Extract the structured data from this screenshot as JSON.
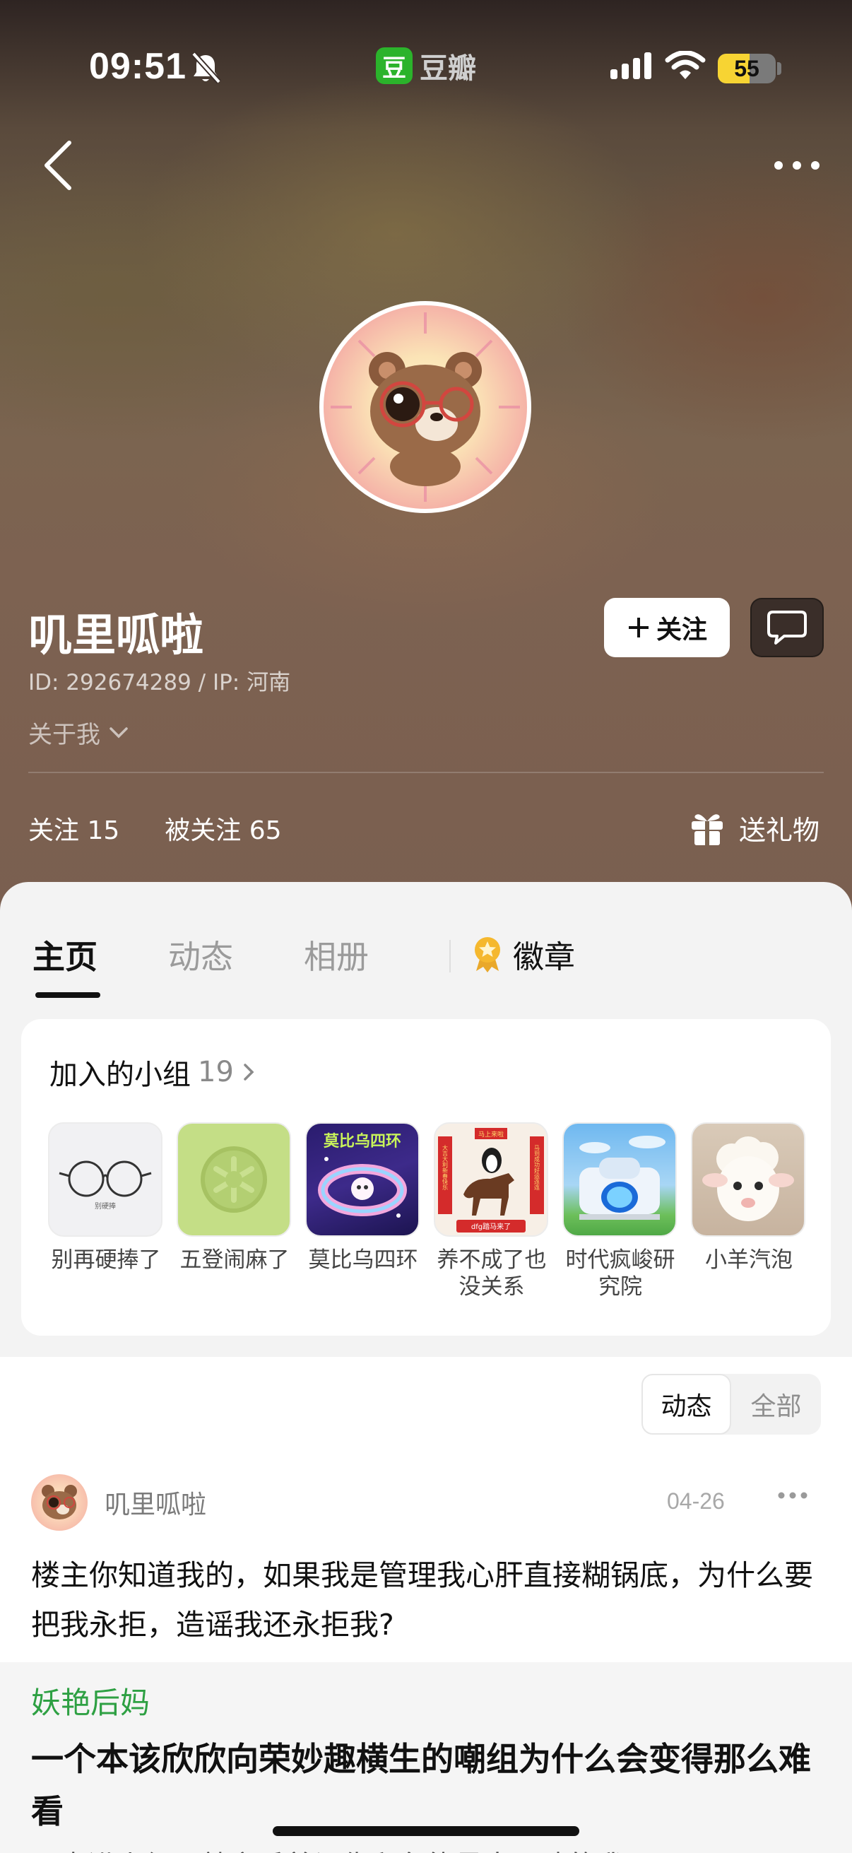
{
  "status_bar": {
    "time": "09:51",
    "app_logo_char": "豆",
    "app_name": "豆瓣",
    "battery_percent": 55,
    "battery_text": "55",
    "icons": [
      "bell-muted-icon",
      "signal-icon",
      "wifi-icon",
      "battery-icon"
    ]
  },
  "nav": {
    "back_icon": "chevron-left-icon",
    "more_icon": "more-horizontal-icon"
  },
  "profile": {
    "name": "叽里呱啦",
    "id_line": "ID: 292674289 / IP: 河南",
    "about_label": "关于我",
    "follow_label": "关注",
    "following": "关注 15",
    "followers": "被关注 65",
    "gift_label": "送礼物"
  },
  "tabs": [
    {
      "label": "主页",
      "active": true
    },
    {
      "label": "动态",
      "active": false
    },
    {
      "label": "相册",
      "active": false
    },
    {
      "label": "徽章",
      "active": false
    }
  ],
  "groups": {
    "title": "加入的小组",
    "count": "19",
    "items": [
      {
        "label": "别再硬捧了"
      },
      {
        "label": "五登闹麻了"
      },
      {
        "label": "莫比乌四环"
      },
      {
        "label": "养不成了也没关系"
      },
      {
        "label": "时代疯峻研究院"
      },
      {
        "label": "小羊汽泡"
      }
    ],
    "thumb_texts": {
      "glasses": "别硬捧",
      "mobius": "莫比乌四环",
      "horse_top": "马上来啦",
      "horse_left": "大吉大利新春快乐",
      "horse_right": "马到成功好运连连",
      "horse_bottom": "dfg踏马来了"
    }
  },
  "feed": {
    "segment": [
      {
        "label": "动态",
        "active": true
      },
      {
        "label": "全部",
        "active": false
      }
    ],
    "post": {
      "user": "叽里呱啦",
      "date": "04-26",
      "text": "楼主你知道我的，如果我是管理我心肝直接糊锅底，为什么要把我永拒，造谣我还永拒我?",
      "quote": {
        "author": "妖艳后妈",
        "title": "一个本该欣欣向荣妙趣横生的嘲组为什么会变得那么难看",
        "sub": "一点进小组下就充斥着记仇和负能量大眼睛的我"
      }
    }
  },
  "colors": {
    "douban_green": "#2bb32b",
    "battery_yellow": "#f7d433",
    "quote_author_green": "#2ea043",
    "badge_gold": "#f5b82e"
  }
}
